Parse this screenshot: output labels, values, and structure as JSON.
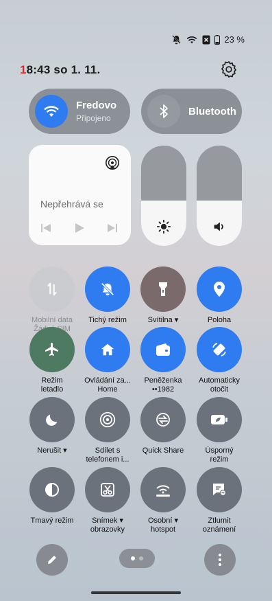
{
  "status_bar": {
    "battery": "23 %"
  },
  "header": {
    "time_prefix": "1",
    "time_rest": "8:43",
    "date": "so 1. 11."
  },
  "wifi": {
    "title": "Fredovo",
    "subtitle": "Připojeno"
  },
  "bluetooth": {
    "title": "Bluetooth"
  },
  "media": {
    "status": "Nepřehrává se"
  },
  "sliders": {
    "brightness_level": 0.45,
    "volume_level": 0.45
  },
  "tiles": [
    {
      "line1": "Mobilní data",
      "line2": "Žádná SIM"
    },
    {
      "line1": "Tichý režim",
      "line2": ""
    },
    {
      "line1": "Svítilna ▾",
      "line2": ""
    },
    {
      "line1": "Poloha",
      "line2": ""
    },
    {
      "line1": "Režim",
      "line2": "letadlo"
    },
    {
      "line1": "Ovládání za...",
      "line2": "Home"
    },
    {
      "line1": "Peněženka",
      "line2": "••1982"
    },
    {
      "line1": "Automaticky",
      "line2": "otočit"
    },
    {
      "line1": "Nerušit ▾",
      "line2": ""
    },
    {
      "line1": "Sdílet s",
      "line2": "telefonem i..."
    },
    {
      "line1": "Quick Share",
      "line2": ""
    },
    {
      "line1": "Úsporný",
      "line2": "režim"
    },
    {
      "line1": "Tmavý režim",
      "line2": ""
    },
    {
      "line1": "Snímek ▾",
      "line2": "obrazovky"
    },
    {
      "line1": "Osobní ▾",
      "line2": "hotspot"
    },
    {
      "line1": "Ztlumit",
      "line2": "oznámení"
    }
  ],
  "colors": {
    "accent": "#2f7bf0",
    "time_highlight": "#e3262c"
  }
}
